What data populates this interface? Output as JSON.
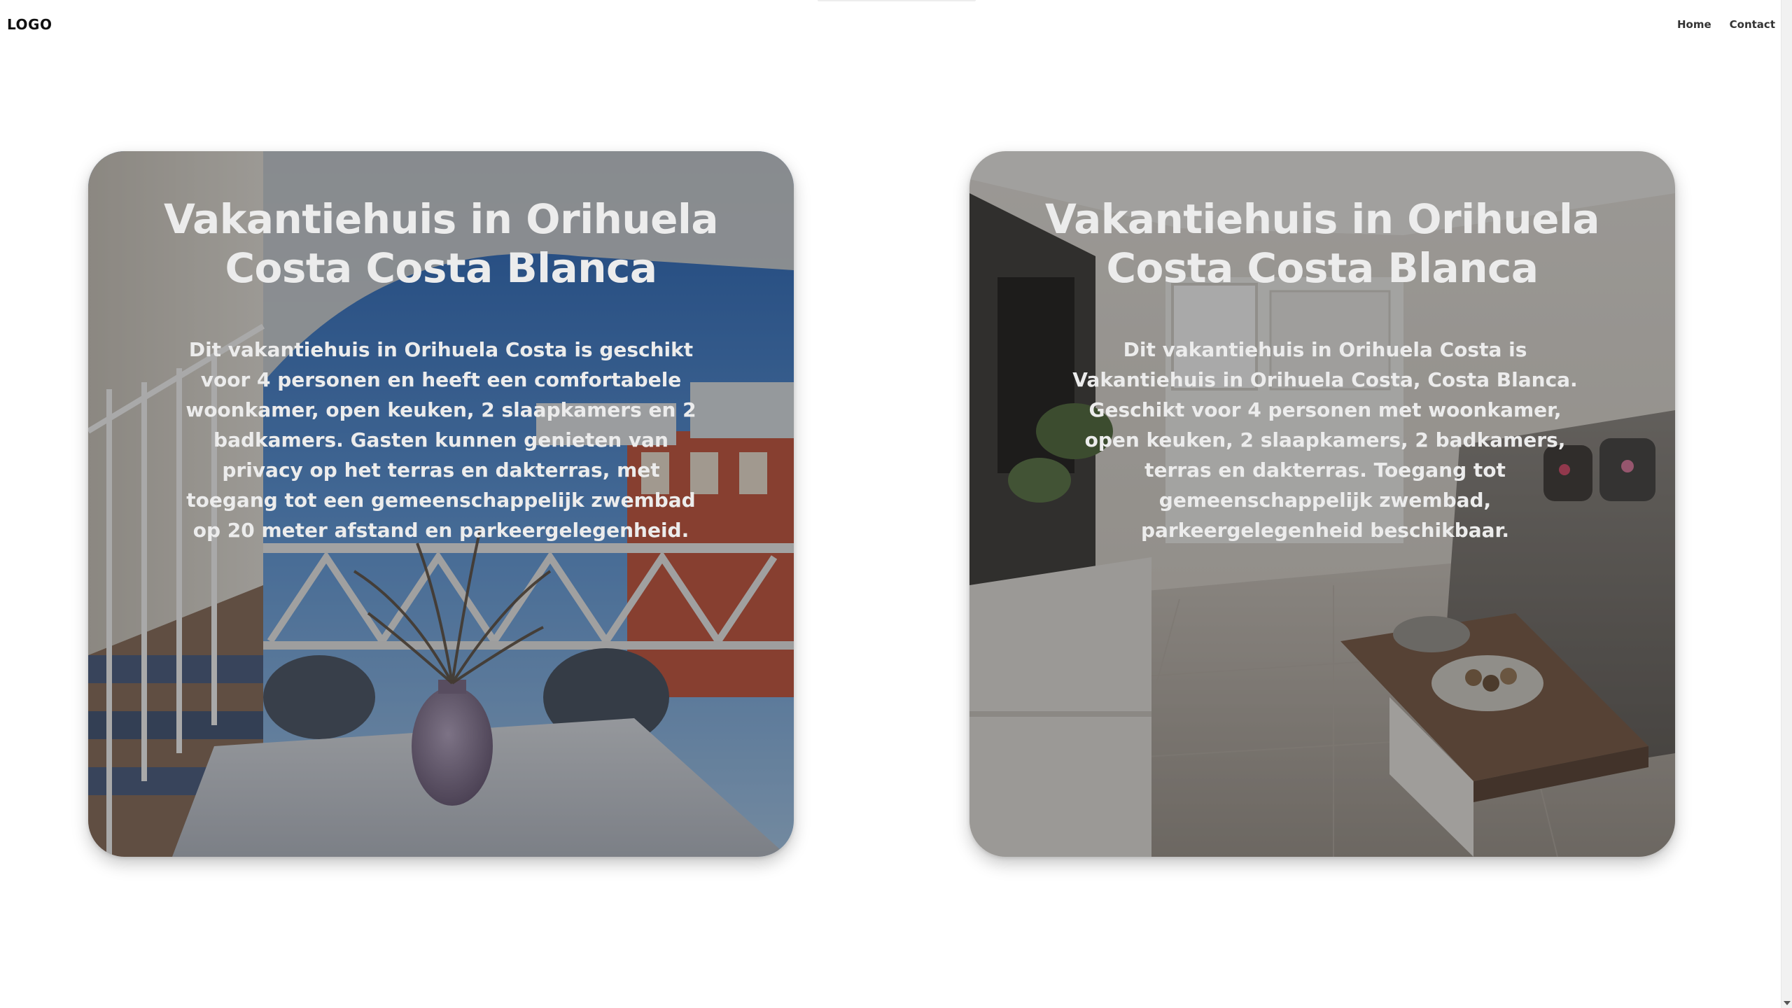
{
  "header": {
    "logo": "LOGO",
    "nav": [
      {
        "label": "Home"
      },
      {
        "label": "Contact"
      }
    ]
  },
  "cards": [
    {
      "title": "Vakantiehuis in Orihuela Costa Costa Blanca",
      "text": "Dit vakantiehuis in Orihuela Costa is geschikt voor 4 personen en heeft een comfortabele woonkamer, open keuken, 2 slaapkamers en 2 badkamers. Gasten kunnen genieten van privacy op het terras en dakterras, met toegang tot een gemeenschappelijk zwembad op 20 meter afstand en parkeergelegenheid.",
      "image": "terrace-dining-photo"
    },
    {
      "title": "Vakantiehuis in Orihuela Costa Costa Blanca",
      "text": "Dit vakantiehuis in Orihuela Costa is Vakantiehuis in Orihuela Costa, Costa Blanca. Geschikt voor 4 personen met woonkamer, open keuken, 2 slaapkamers, 2 badkamers, terras en dakterras. Toegang tot gemeenschappelijk zwembad, parkeergelegenheid beschikbaar.",
      "image": "living-room-photo"
    }
  ],
  "colors": {
    "overlay": "#1e1e1e",
    "card_text": "#ececec",
    "logo": "#111111"
  }
}
